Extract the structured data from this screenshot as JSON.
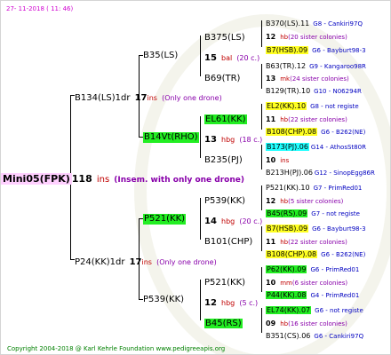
{
  "header": {
    "date": "27- 11-2018 ( 11: 46)"
  },
  "footer": {
    "copyright": "Copyright 2004-2018 @ Karl Kehrle Foundation    www.pedigreeapis.org"
  },
  "root": {
    "name": "Mini05(FPK)",
    "num": "118",
    "suffix": "ins",
    "note": "(Insem. with only one drone)"
  },
  "g1": [
    {
      "name": "B134(LS)1dr",
      "num": "17",
      "suffix": "ins",
      "note": "(Only one drone)"
    },
    {
      "name": "P24(KK)1dr",
      "num": "17",
      "suffix": "ins",
      "note": "(Only one drone)"
    }
  ],
  "g2": [
    {
      "name": "B35(LS)"
    },
    {
      "name": "B14Vt(RHO)"
    },
    {
      "name": "P521(KK)"
    },
    {
      "name": "P539(KK)"
    }
  ],
  "g3": [
    {
      "name": "B375(LS)",
      "num": "15",
      "suffix": "bal",
      "note": "(20 c.)"
    },
    {
      "name": "B69(TR)"
    },
    {
      "name": "EL61(KK)",
      "num": "13",
      "suffix": "hbg",
      "note": "(18 c.)"
    },
    {
      "name": "B235(PJ)"
    },
    {
      "name": "P539(KK)",
      "num": "14",
      "suffix": "hbg",
      "note": "(20 c.)"
    },
    {
      "name": "B101(CHP)"
    },
    {
      "name": "P521(KK)",
      "num": "12",
      "suffix": "hbg",
      "note": "(5 c.)"
    },
    {
      "name": "B45(RS)"
    }
  ],
  "g4": [
    {
      "name": "B370(LS).11",
      "code": "G8 - Cankiri97Q"
    },
    {
      "num": "12",
      "suffix": "hb",
      "note": "(20 sister colonies)"
    },
    {
      "name": "B7(HSB).09",
      "code": "G6 - Bayburt98-3"
    },
    {
      "name": "B63(TR).12",
      "code": "G9 - Kangaroo98R"
    },
    {
      "num": "13",
      "suffix": "mk",
      "note": "(24 sister colonies)"
    },
    {
      "name": "B129(TR).10",
      "code": "G10 - N06294R"
    },
    {
      "name": "EL2(KK).10",
      "code": "G8 - not registe"
    },
    {
      "num": "11",
      "suffix": "hb",
      "note": "(22 sister colonies)"
    },
    {
      "name": "B108(CHP).08",
      "code": "G6 - B262(NE)"
    },
    {
      "name": "B173(PJ).06",
      "code": "G14 - AthosSt80R"
    },
    {
      "num": "10",
      "suffix": "ins",
      "note": ""
    },
    {
      "name": "B213H(PJ).06",
      "code": "G12 - SinopEgg86R"
    },
    {
      "name": "P521(KK).10",
      "code": "G7 - PrimRed01"
    },
    {
      "num": "12",
      "suffix": "hb",
      "note": "(5 sister colonies)"
    },
    {
      "name": "B45(RS).09",
      "code": "G7 - not registe"
    },
    {
      "name": "B7(HSB).09",
      "code": "G6 - Bayburt98-3"
    },
    {
      "num": "11",
      "suffix": "hb",
      "note": "(22 sister colonies)"
    },
    {
      "name": "B108(CHP).08",
      "code": "G6 - B262(NE)"
    },
    {
      "name": "P62(KK).09",
      "code": "G6 - PrimRed01"
    },
    {
      "num": "10",
      "suffix": "mm",
      "note": "(6 sister colonies)"
    },
    {
      "name": "P44(KK).08",
      "code": "G4 - PrimRed01"
    },
    {
      "name": "EL74(KK).07",
      "code": "G6 - not registe"
    },
    {
      "num": "09",
      "suffix": "hb",
      "note": "(16 sister colonies)"
    },
    {
      "name": "B351(CS).06",
      "code": "G6 - Cankiri97Q"
    }
  ],
  "colors": {
    "insem": "#8800aa",
    "num": "#c00000",
    "code": "#0000c0",
    "green": "#22ee22",
    "yellow": "#ffff22",
    "cyan": "#22ffff"
  }
}
